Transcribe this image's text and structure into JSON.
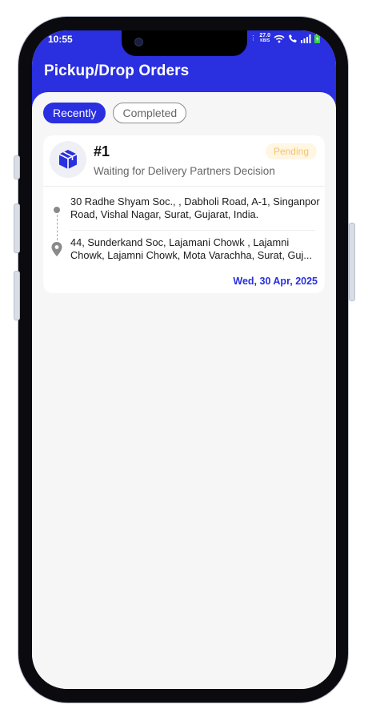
{
  "status_bar": {
    "time": "10:55",
    "net_speed_value": "27.0",
    "net_speed_unit": "KB/S"
  },
  "header": {
    "title": "Pickup/Drop Orders"
  },
  "tabs": [
    {
      "label": "Recently",
      "active": true
    },
    {
      "label": "Completed",
      "active": false
    }
  ],
  "order": {
    "id": "#1",
    "subtitle": "Waiting for Delivery Partners Decision",
    "status": "Pending",
    "pickup_address": "30 Radhe Shyam Soc., , Dabholi Road, A-1, Singanpor Road, Vishal Nagar, Surat, Gujarat, India.",
    "drop_address_line1": "44, Sunderkand Soc, Lajamani Chowk , Lajamni",
    "drop_address_line2": "Chowk, Lajamni Chowk, Mota Varachha, Surat, Guj...",
    "date": "Wed, 30 Apr, 2025"
  },
  "bottom_nav": {
    "items": [
      {
        "icon": "home-icon",
        "active": false
      },
      {
        "icon": "package-icon",
        "active": true
      },
      {
        "icon": "truck-icon",
        "active": false
      },
      {
        "icon": "profile-icon",
        "active": false
      }
    ]
  },
  "colors": {
    "accent": "#2a2fe0",
    "pending_bg": "#fff6e3",
    "pending_text": "#f3c470"
  }
}
